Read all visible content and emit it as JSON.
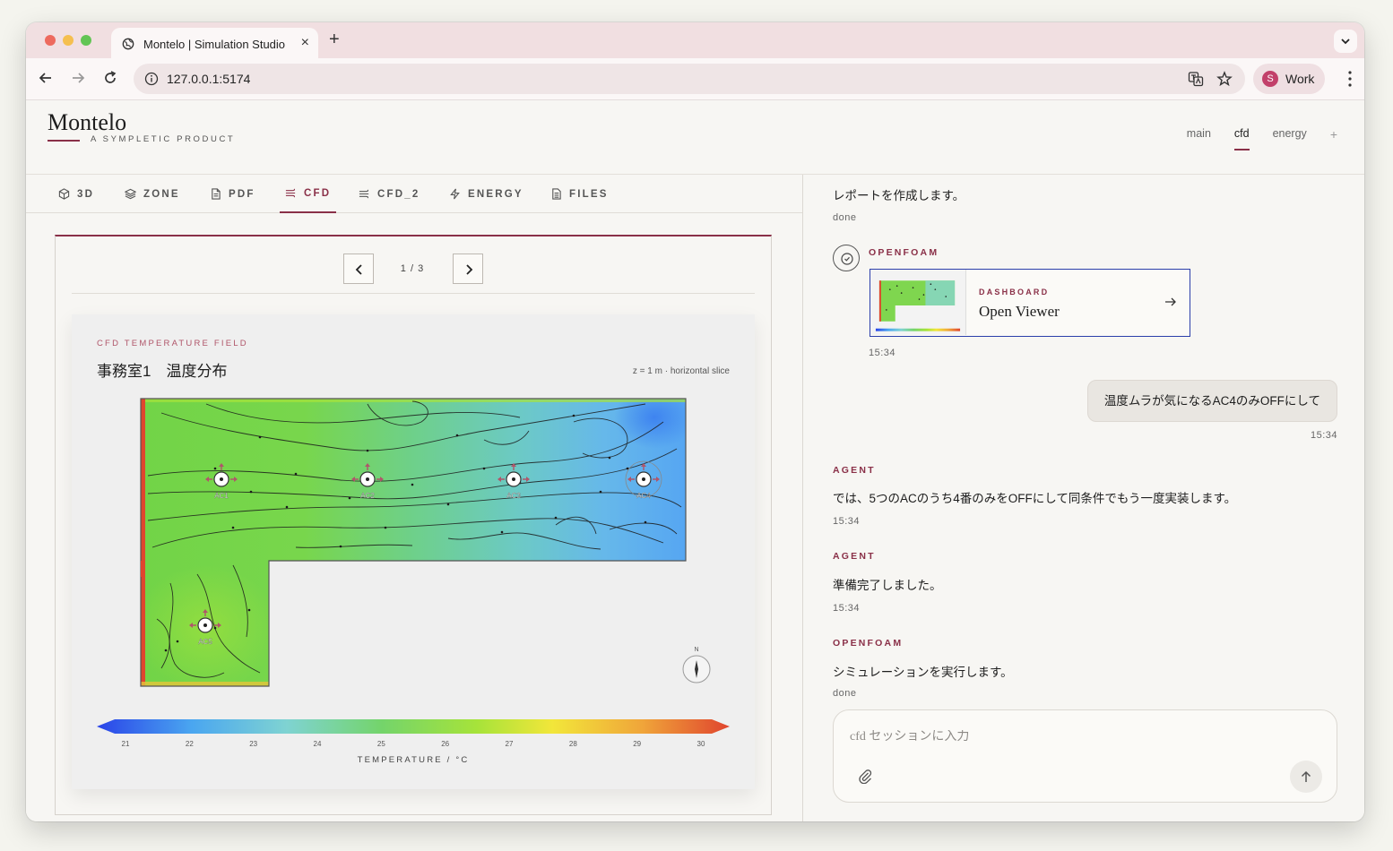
{
  "browser": {
    "tab_title": "Montelo | Simulation Studio",
    "url": "127.0.0.1:5174",
    "profile_initial": "S",
    "profile_label": "Work"
  },
  "app": {
    "logo": "Montelo",
    "logo_sub": "A SYMPLETIC PRODUCT",
    "session_tabs": [
      {
        "label": "main",
        "active": false
      },
      {
        "label": "cfd",
        "active": true
      },
      {
        "label": "energy",
        "active": false
      }
    ],
    "session_add": "+"
  },
  "module_tabs": [
    {
      "label": "3D",
      "icon": "cube-icon"
    },
    {
      "label": "ZONE",
      "icon": "layers-icon"
    },
    {
      "label": "PDF",
      "icon": "document-icon"
    },
    {
      "label": "CFD",
      "icon": "flow-icon",
      "active": true
    },
    {
      "label": "CFD_2",
      "icon": "flow-icon"
    },
    {
      "label": "ENERGY",
      "icon": "bolt-icon"
    },
    {
      "label": "FILES",
      "icon": "file-icon"
    }
  ],
  "viewer": {
    "page_label": "1 / 3",
    "card_overline": "CFD TEMPERATURE FIELD",
    "card_title": "事務室1　温度分布",
    "slice_info": "z = 1 m  ·  horizontal slice",
    "ac_units": [
      "AC1",
      "AC2",
      "AC3",
      "AC4",
      "AC5"
    ],
    "compass_label": "N",
    "colorbar_title": "TEMPERATURE / °C"
  },
  "chart_data": {
    "type": "heatmap",
    "title": "事務室1　温度分布",
    "xlabel": "TEMPERATURE / °C",
    "colorbar_ticks": [
      21,
      22,
      23,
      24,
      25,
      26,
      27,
      28,
      29,
      30
    ],
    "colorbar_range": [
      21,
      30
    ],
    "colors": [
      "#2a43e8",
      "#4aa6f0",
      "#7fd3d2",
      "#74d46b",
      "#a6e33a",
      "#f2e63a",
      "#f0a63a",
      "#e0452e"
    ]
  },
  "chat": {
    "msg1_text": "レポートを作成します。",
    "msg1_status": "done",
    "tool_role": "OPENFOAM",
    "dash_overline": "DASHBOARD",
    "dash_title": "Open Viewer",
    "dash_time": "15:34",
    "user_msg": "温度ムラが気になるAC4のみOFFにして",
    "user_time": "15:34",
    "agent1_role": "AGENT",
    "agent1_text": "では、5つのACのうち4番のみをOFFにして同条件でもう一度実装します。",
    "agent1_time": "15:34",
    "agent2_role": "AGENT",
    "agent2_text": "準備完了しました。",
    "agent2_time": "15:34",
    "tool2_role": "OPENFOAM",
    "tool2_text": "シミュレーションを実行します。",
    "tool2_status": "done",
    "composer_placeholder": "cfd セッションに入力"
  }
}
